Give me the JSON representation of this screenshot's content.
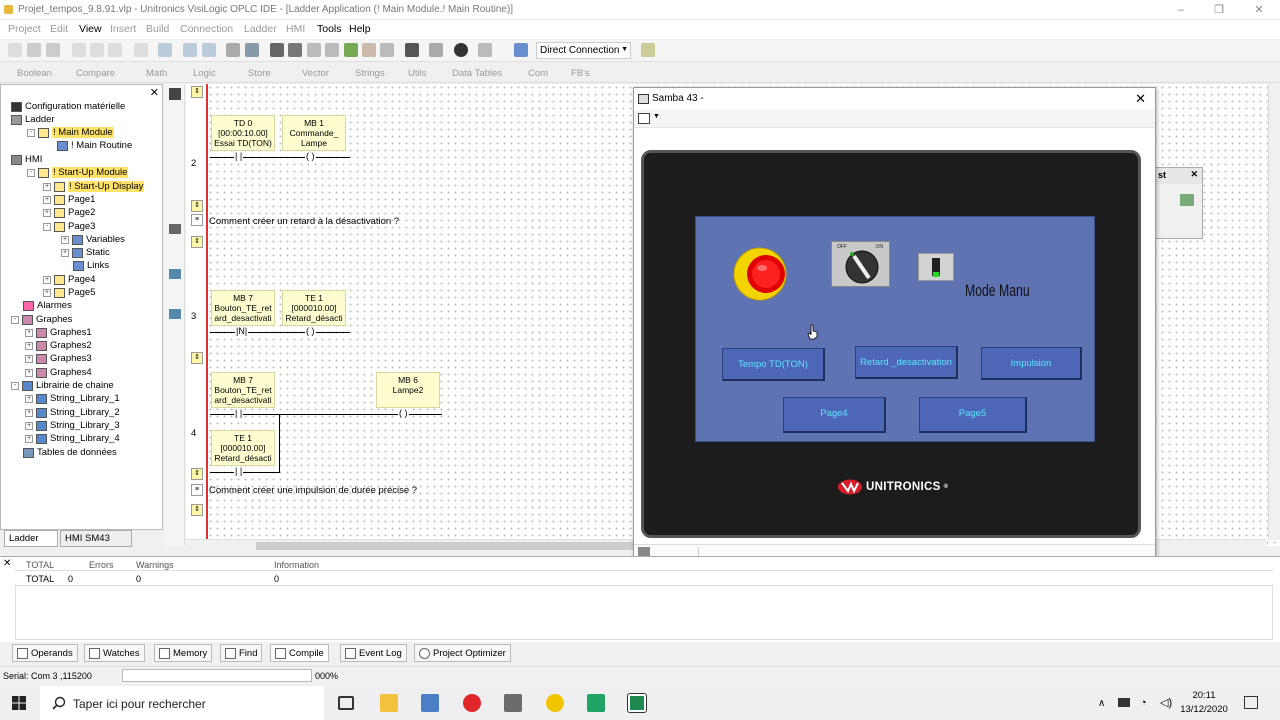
{
  "window": {
    "title": "Projet_tempos_9.8.91.vlp - Unitronics VisiLogic OPLC IDE - [Ladder Application (! Main Module.! Main Routine)]"
  },
  "menu": [
    "Project",
    "Edit",
    "View",
    "Insert",
    "Build",
    "Connection",
    "Ladder",
    "HMI",
    "Tools",
    "Help"
  ],
  "toolbar": {
    "connection_select": "Direct Connection"
  },
  "toolbar2": [
    "Boolean",
    "Compare",
    "Math",
    "Logic",
    "Store",
    "Vector",
    "Strings",
    "Utils",
    "Data Tables",
    "Com",
    "FB's"
  ],
  "tree": {
    "items": [
      {
        "label": "Configuration matérielle"
      },
      {
        "label": "Ladder"
      },
      {
        "label": "! Main Module"
      },
      {
        "label": "! Main Routine"
      },
      {
        "label": "HMI"
      },
      {
        "label": "! Start-Up Module"
      },
      {
        "label": "! Start-Up Display"
      },
      {
        "label": "Page1"
      },
      {
        "label": "Page2"
      },
      {
        "label": "Page3"
      },
      {
        "label": "Variables"
      },
      {
        "label": "Static"
      },
      {
        "label": "Links"
      },
      {
        "label": "Page4"
      },
      {
        "label": "Page5"
      },
      {
        "label": "Alarmes"
      },
      {
        "label": "Graphes"
      },
      {
        "label": "Graphes1"
      },
      {
        "label": "Graphes2"
      },
      {
        "label": "Graphes3"
      },
      {
        "label": "Graphes4"
      },
      {
        "label": "Librairie de chaine"
      },
      {
        "label": "String_Library_1"
      },
      {
        "label": "String_Library_2"
      },
      {
        "label": "String_Library_3"
      },
      {
        "label": "String_Library_4"
      },
      {
        "label": "Tables de données"
      }
    ],
    "tabs": [
      "Ladder",
      "HMI SM43"
    ]
  },
  "ladder": {
    "row2": {
      "num": "2",
      "contact": {
        "line1": "TD 0",
        "line2": "[00:00:10.00]",
        "line3": "Essai TD(TON)"
      },
      "coil": {
        "line1": "MB 1",
        "line2": "Commande_",
        "line3": "Lampe"
      }
    },
    "comment1": "Comment créer un retard à la désactivation ?",
    "row3": {
      "num": "3",
      "contact": {
        "line1": "MB 7",
        "line2": "Bouton_TE_ret",
        "line3": "ard_desactivati"
      },
      "coil": {
        "line1": "TE 1",
        "line2": "[000010.00]",
        "line3": "Retard_désacti"
      },
      "contact_symbol": "N"
    },
    "row4": {
      "num": "4",
      "contact": {
        "line1": "MB 7",
        "line2": "Bouton_TE_ret",
        "line3": "ard_desactivati"
      },
      "contact2": {
        "line1": "TE 1",
        "line2": "[000010.00]",
        "line3": "Retard_désacti"
      },
      "coil": {
        "line1": "MB 6",
        "line2": "Lampe2"
      }
    },
    "comment2": "Comment créer une impulsion de durée précise ?"
  },
  "samba": {
    "title": "Samba 43 -",
    "hmi": {
      "mode_label": "Mode Manu",
      "selector_off": "OFF",
      "selector_on": "ON",
      "buttons": [
        "Tempo TD(TON)",
        "Retard _desactivation",
        "Impulsion",
        "Page4",
        "Page5"
      ],
      "logo": "UNITRONICS",
      "logo_mark": "®"
    }
  },
  "floatwin": {
    "label": "st"
  },
  "output": {
    "headers": [
      "TOTAL",
      "Errors",
      "Warnings",
      "Information"
    ],
    "row": [
      "TOTAL",
      "0",
      "0",
      "0"
    ],
    "tabs": [
      "Operands",
      "Watches",
      "Memory",
      "Find",
      "Compile",
      "Event Log",
      "Project Optimizer"
    ]
  },
  "statusbar": {
    "serial": "Serial:  Com 3 ,115200",
    "percent": "000%"
  },
  "taskbar": {
    "search_placeholder": "Taper ici pour rechercher",
    "time": "20:11",
    "date": "13/12/2020"
  },
  "colors": {
    "hmi_screen": "#5f72b2",
    "hmi_button": "#4d66b6",
    "hmi_button_text": "#5ce7ff",
    "rail": "#e03030",
    "highlight": "#ffe36b"
  }
}
